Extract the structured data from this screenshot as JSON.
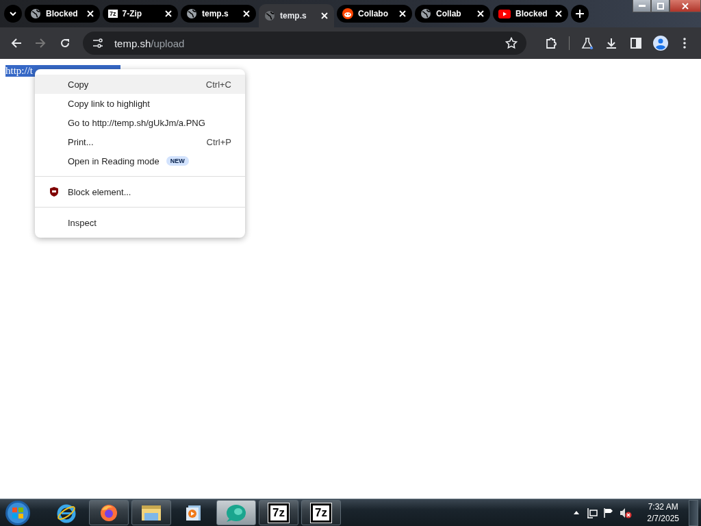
{
  "tab_strip": {
    "tabs": [
      {
        "title": "Blocked",
        "selected": false
      },
      {
        "title": "7-Zip",
        "favicon_text": "7z",
        "selected": false
      },
      {
        "title": "temp.s",
        "selected": false
      },
      {
        "title": "temp.s",
        "selected": true
      },
      {
        "title": "Collabo",
        "selected": false
      },
      {
        "title": "Collab",
        "selected": false
      },
      {
        "title": "Blocked",
        "selected": false
      }
    ]
  },
  "toolbar": {
    "address": {
      "host": "temp.sh",
      "path": "/upload"
    }
  },
  "page": {
    "selected_text": "http://t"
  },
  "context_menu": {
    "items": [
      {
        "kind": "item",
        "label": "Copy",
        "shortcut": "Ctrl+C",
        "selected": true
      },
      {
        "kind": "item",
        "label": "Copy link to highlight",
        "selected": false
      },
      {
        "kind": "item",
        "label": "Go to http://temp.sh/gUkJm/a.PNG",
        "selected": false
      },
      {
        "kind": "item",
        "label": "Print...",
        "shortcut": "Ctrl+P",
        "selected": false
      },
      {
        "kind": "item",
        "label": "Open in Reading mode",
        "badge": "NEW",
        "selected": false
      },
      {
        "kind": "separator"
      },
      {
        "kind": "item",
        "label": "Block element...",
        "selected": false
      },
      {
        "kind": "separator"
      },
      {
        "kind": "item",
        "label": "Inspect",
        "selected": false
      }
    ]
  },
  "taskbar": {
    "items": [
      {
        "running": false,
        "selected": false
      },
      {
        "running": true,
        "selected": false
      },
      {
        "running": true,
        "selected": false
      },
      {
        "running": false,
        "selected": false
      },
      {
        "running": true,
        "selected": true
      },
      {
        "label": "7z",
        "running": true,
        "selected": false
      },
      {
        "label": "7z",
        "running": true,
        "selected": false
      }
    ],
    "clock": {
      "time": "7:32 AM",
      "date": "2/7/2025"
    }
  }
}
